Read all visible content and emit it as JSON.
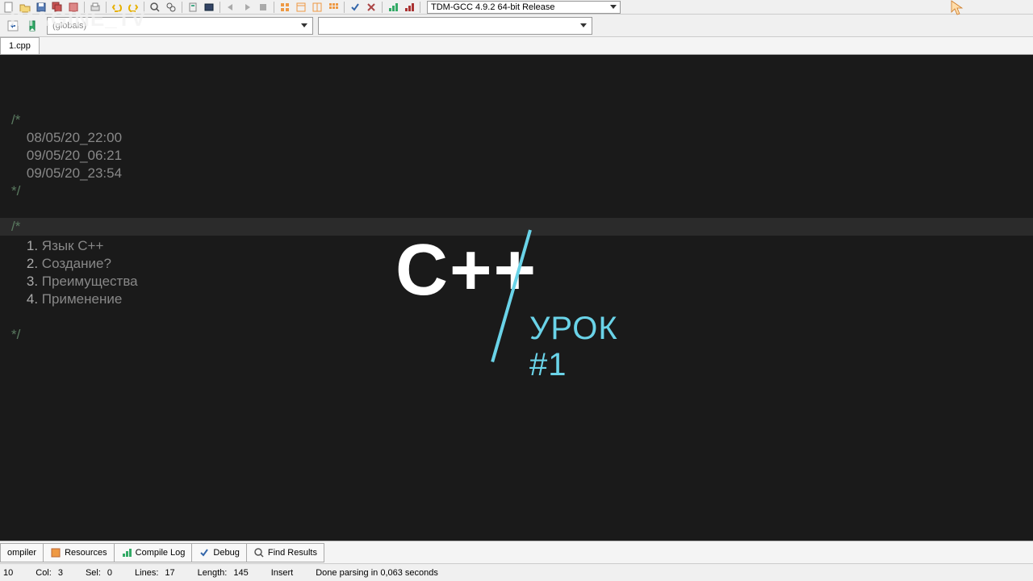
{
  "toolbar": {
    "compiler": "TDM-GCC 4.9.2 64-bit Release",
    "globals_combo": "(globals)"
  },
  "tabs": {
    "file": "1.cpp"
  },
  "code": {
    "c1": "/*",
    "d1": "    08/05/20_22:00",
    "d2": "    09/05/20_06:21",
    "d3": "    09/05/20_23:54",
    "c2": "*/",
    "c3": "/*",
    "l1n": "    1. ",
    "l1t": "Язык С++",
    "l2n": "    2. ",
    "l2t": "Создание?",
    "l3n": "    3. ",
    "l3t": "Преимущества",
    "l4n": "    4. ",
    "l4t": "Применение",
    "c4": "*/"
  },
  "overlay": {
    "cpp": "C++",
    "lesson": "УРОК #1"
  },
  "watermark": "IMAGINE_TV",
  "bottom_tabs": {
    "compiler": "ompiler",
    "resources": "Resources",
    "compile_log": "Compile Log",
    "debug": "Debug",
    "find_results": "Find Results"
  },
  "status": {
    "row_val": "10",
    "col_lbl": "Col:",
    "col_val": "3",
    "sel_lbl": "Sel:",
    "sel_val": "0",
    "lines_lbl": "Lines:",
    "lines_val": "17",
    "length_lbl": "Length:",
    "length_val": "145",
    "mode": "Insert",
    "msg": "Done parsing in 0,063 seconds"
  }
}
